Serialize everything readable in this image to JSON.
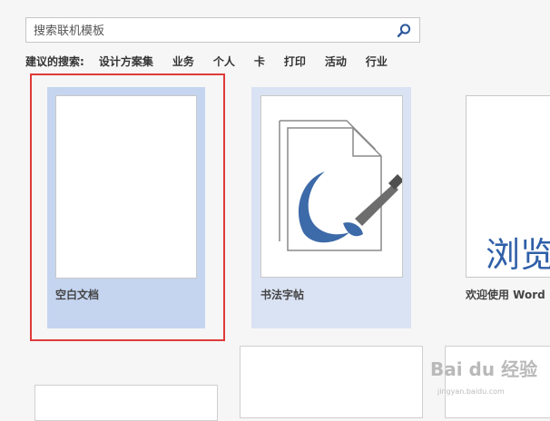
{
  "search": {
    "placeholder": "搜索联机模板",
    "button_icon": "search-icon"
  },
  "suggested": {
    "label": "建议的搜索:",
    "items": [
      "设计方案集",
      "业务",
      "个人",
      "卡",
      "打印",
      "活动",
      "行业"
    ]
  },
  "templates": [
    {
      "name": "空白文档",
      "selected": true
    },
    {
      "name": "书法字帖",
      "selected": false
    },
    {
      "name": "欢迎使用 Word",
      "preview_text": "浏览"
    }
  ],
  "watermark": {
    "text": "Bai du 经验",
    "subtext": "jingyan.baidu.com"
  },
  "colors": {
    "selection_frame": "#e03a3a",
    "blank_tile_bg": "#c5d5f0",
    "calligraphy_tile_bg": "#dae3f3",
    "accent_blue": "#2f5fa8"
  }
}
